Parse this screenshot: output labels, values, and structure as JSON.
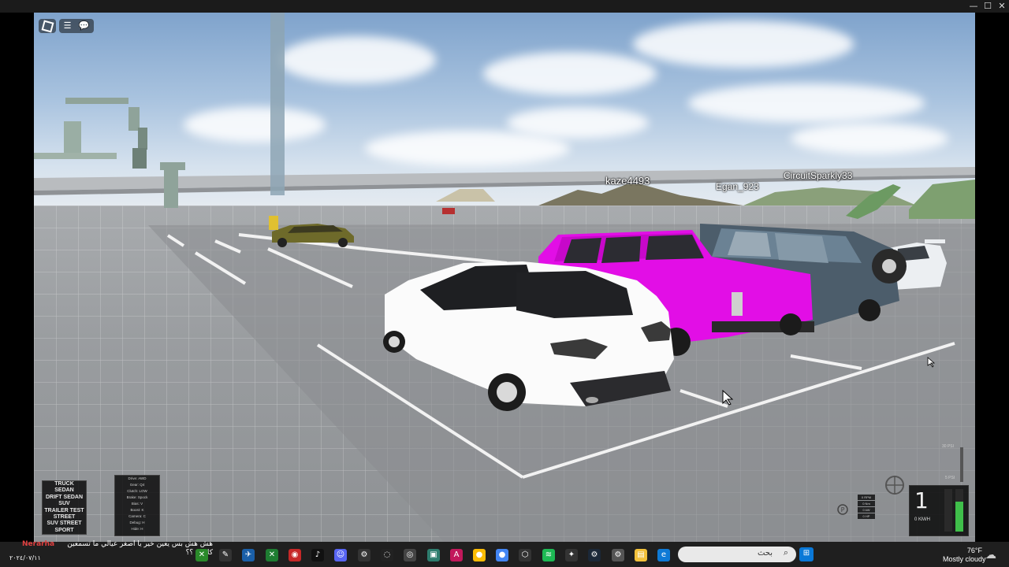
{
  "window": {
    "minimize": "—",
    "maximize": "☐",
    "close": "✕"
  },
  "roblox": {
    "logo_icon": "roblox-logo-icon",
    "menu_icon": "☰",
    "chat_icon": "💬"
  },
  "players": [
    "kaze4493",
    "Egan_923",
    "CircuitSparkly33"
  ],
  "car_menu": [
    "TRUCK",
    "SEDAN",
    "DRIFT SEDAN",
    "SUV",
    "TRAILER TEST",
    "STREET",
    "SUV STREET",
    "SPORT"
  ],
  "car_stats": [
    "Drive: AWD",
    "Gear: Q4",
    "Clutch: LOW",
    "Brake: Spock",
    "Bias: V",
    "Boost: K",
    "Camera: C",
    "Debug: H",
    "Hide: H"
  ],
  "hud": {
    "gear": "1",
    "speed": "0 KM/H",
    "psi_top": "30 PSI",
    "psi_bottom": "5 PSI",
    "boost_fraction": 0.7,
    "mini": [
      "0 RPM",
      "0 Nm",
      "0 kW",
      "0 HP"
    ]
  },
  "taskbar": {
    "chat_name": "Nerarha",
    "chat_message": "هش هش بس يعين خير يا اصغر عيالي ما تسمعين كلامي ؟؟",
    "date": "٢٠٢٤/٠٧/١١",
    "search_placeholder": "بحث",
    "temperature": "76°F",
    "weather": "Mostly cloudy"
  }
}
